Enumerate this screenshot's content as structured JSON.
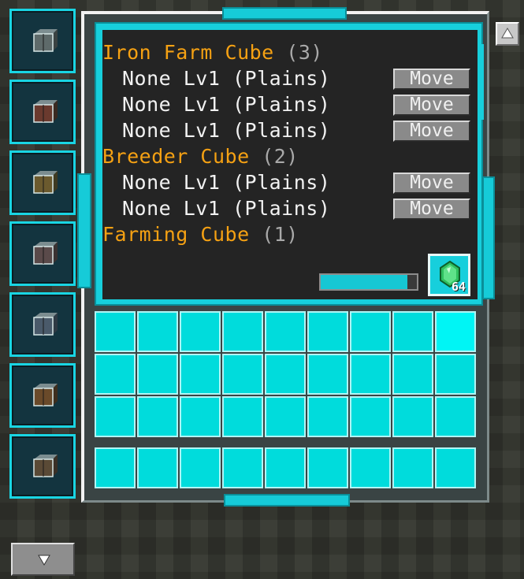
{
  "tabs": [
    {
      "icon": "iron-farm-cube-icon",
      "color": "#5e6a6a"
    },
    {
      "icon": "breeder-cube-icon",
      "color": "#6a3a2e"
    },
    {
      "icon": "farming-cube-icon",
      "color": "#6b5a2e"
    },
    {
      "icon": "cube-icon",
      "color": "#5a4a4a"
    },
    {
      "icon": "cube-icon",
      "color": "#4a5a6a"
    },
    {
      "icon": "cube-icon",
      "color": "#6a4a2a"
    },
    {
      "icon": "cube-icon",
      "color": "#5a4a36"
    }
  ],
  "list": [
    {
      "type": "header",
      "name": "Iron Farm Cube",
      "count": "(3)"
    },
    {
      "type": "item",
      "text": "None Lv1 (Plains)",
      "button": "Move"
    },
    {
      "type": "item",
      "text": "None Lv1 (Plains)",
      "button": "Move"
    },
    {
      "type": "item",
      "text": "None Lv1 (Plains)",
      "button": "Move"
    },
    {
      "type": "header",
      "name": "Breeder Cube",
      "count": "(2)"
    },
    {
      "type": "item",
      "text": "None Lv1 (Plains)",
      "button": "Move"
    },
    {
      "type": "item",
      "text": "None Lv1 (Plains)",
      "button": "Move"
    },
    {
      "type": "header",
      "name": "Farming Cube",
      "count": "(1)"
    }
  ],
  "progress": 0.9,
  "emerald": {
    "count": "64",
    "icon": "emerald-icon",
    "color": "#2fbf5f"
  },
  "colors": {
    "accent": "#17cfdc",
    "header": "#f5a113",
    "slot": "#00dcdc"
  },
  "side_buttons": {
    "up_icon": "up-arrow-icon",
    "down_icon": "down-arrow-icon"
  }
}
